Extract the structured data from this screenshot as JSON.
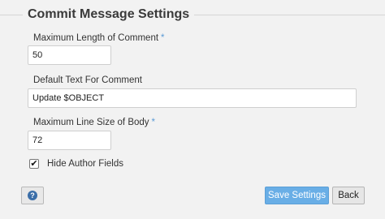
{
  "section": {
    "title": "Commit Message Settings"
  },
  "fields": {
    "max_length": {
      "label": "Maximum Length of Comment",
      "required_mark": "*",
      "value": "50"
    },
    "default_text": {
      "label": "Default Text For Comment",
      "value": "Update $OBJECT"
    },
    "max_line_size": {
      "label": "Maximum Line Size of Body",
      "required_mark": "*",
      "value": "72"
    }
  },
  "hide_author": {
    "label": "Hide Author Fields",
    "checked": true,
    "check_glyph": "✔"
  },
  "buttons": {
    "help_icon": "help-icon",
    "help_glyph": "?",
    "save": "Save Settings",
    "back": "Back"
  },
  "colors": {
    "accent": "#5b9bd5",
    "save_button": "#69aee6",
    "help_icon": "#3b6ea8",
    "background": "#f2f2f2"
  }
}
